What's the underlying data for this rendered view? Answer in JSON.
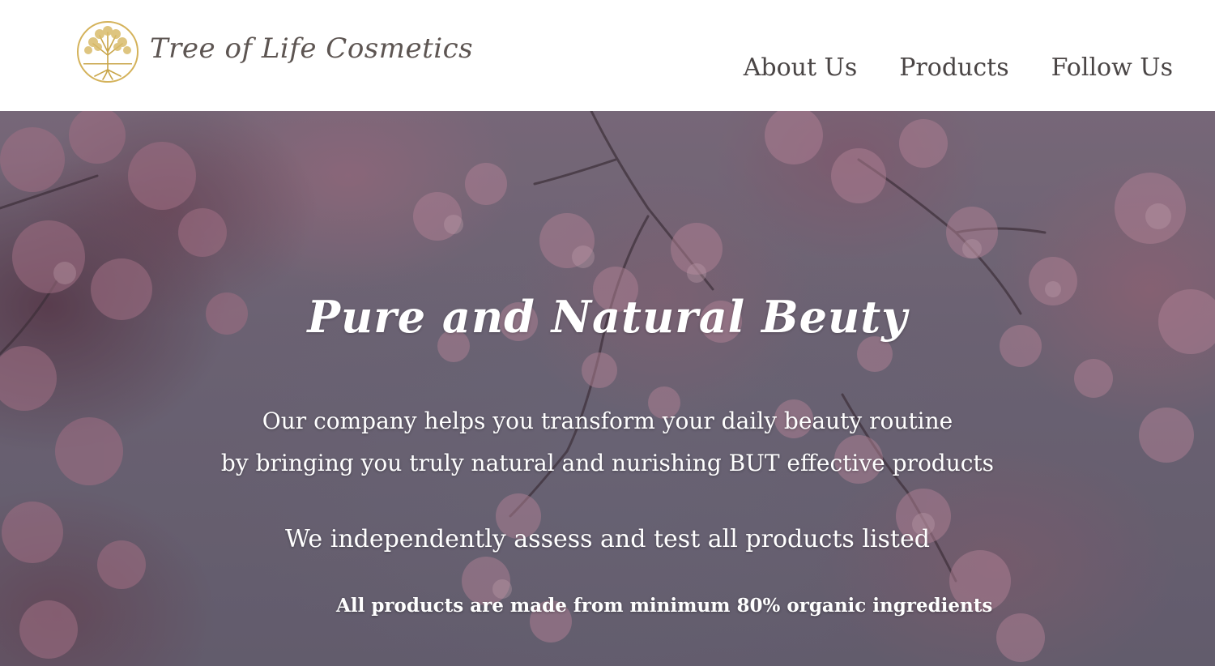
{
  "brand": {
    "name": "Tree of Life Cosmetics",
    "logo_icon": "tree-of-life-icon",
    "logo_color": "#d4b25a"
  },
  "nav": {
    "items": [
      {
        "label": "About Us"
      },
      {
        "label": "Products"
      },
      {
        "label": "Follow Us"
      }
    ]
  },
  "hero": {
    "title": "Pure and Natural Beuty",
    "line1": "Our company helps you transform your daily beauty routine",
    "line2": "by bringing you truly natural and nurishing BUT effective products",
    "line3": "We independently assess and test all products listed",
    "note": "All products are made from minimum 80% organic ingredients",
    "background_image": "pink-cherry-blossom-branches"
  },
  "colors": {
    "header_bg": "#ffffff",
    "nav_text": "#4a4545",
    "hero_text": "#ffffff",
    "blossom_pink": "#c98a9c"
  }
}
